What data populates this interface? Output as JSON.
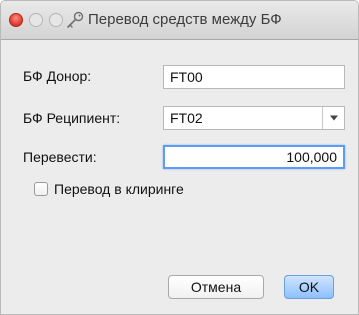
{
  "window": {
    "title": "Перевод средств между БФ"
  },
  "form": {
    "donor_label": "БФ Донор:",
    "donor_value": "FT00",
    "recipient_label": "БФ Реципиент:",
    "recipient_value": "FT02",
    "amount_label": "Перевести:",
    "amount_value": "100,000",
    "clearing_label": "Перевод в клиринге",
    "clearing_checked": false
  },
  "buttons": {
    "cancel_label": "Отмена",
    "ok_label": "OK"
  },
  "colors": {
    "accent": "#5e9cf2",
    "close_button": "#d9362b",
    "default_button": "#8ec0ff"
  },
  "icons": {
    "title_icon": "key-icon",
    "combo_arrow": "chevron-down-icon"
  }
}
